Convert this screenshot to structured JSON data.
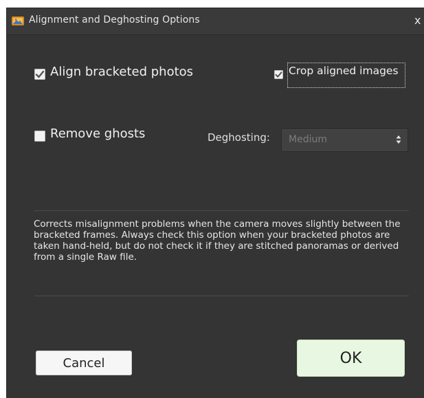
{
  "window": {
    "title": "Alignment and Deghosting Options",
    "close_glyph": "x"
  },
  "options": {
    "align_bracketed": {
      "label": "Align bracketed photos",
      "checked": true
    },
    "crop_aligned": {
      "label": "Crop aligned images",
      "checked": true
    },
    "remove_ghosts": {
      "label": "Remove ghosts",
      "checked": false
    }
  },
  "deghosting": {
    "label": "Deghosting:",
    "value": "Medium",
    "enabled": false
  },
  "description": "Corrects misalignment problems when the camera moves slightly between the bracketed frames. Always check this option when your bracketed photos are taken hand-held, but do not check it if they are stitched panoramas or derived from a single Raw file.",
  "buttons": {
    "cancel": "Cancel",
    "ok": "OK"
  },
  "icons": {
    "app": "app-icon",
    "close": "close-icon",
    "checkmark": "checkmark-icon",
    "select_arrows": "updown-arrows-icon"
  },
  "colors": {
    "dialog_bg": "#343434",
    "ok_bg": "#e8f7e1",
    "cancel_bg": "#f6f6f6"
  }
}
